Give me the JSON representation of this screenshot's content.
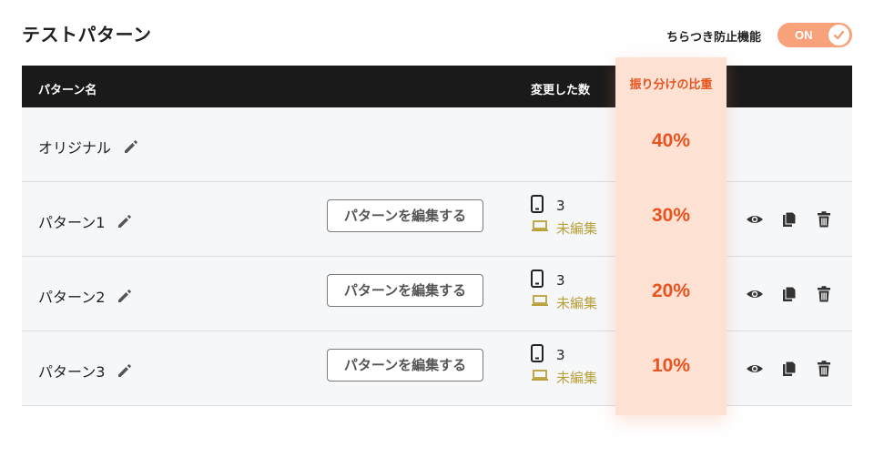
{
  "title": "テストパターン",
  "flicker": {
    "label": "ちらつき防止機能",
    "toggle_text": "ON"
  },
  "table": {
    "headers": {
      "name": "パターン名",
      "changes": "変更した数",
      "ratio": "振り分けの比重"
    },
    "rows": [
      {
        "name": "オリジナル",
        "ratio": "40%"
      },
      {
        "name": "パターン1",
        "edit_label": "パターンを編集する",
        "mobile_count": "3",
        "pc_status": "未編集",
        "ratio": "30%"
      },
      {
        "name": "パターン2",
        "edit_label": "パターンを編集する",
        "mobile_count": "3",
        "pc_status": "未編集",
        "ratio": "20%"
      },
      {
        "name": "パターン3",
        "edit_label": "パターンを編集する",
        "mobile_count": "3",
        "pc_status": "未編集",
        "ratio": "10%"
      }
    ]
  },
  "icons": {
    "pencil": "pencil-icon",
    "mobile": "smartphone-icon",
    "laptop": "laptop-icon",
    "preview": "eye-icon",
    "copy": "copy-icon",
    "delete": "trash-icon",
    "check": "check-icon"
  },
  "colors": {
    "accent": "#e8531f",
    "toggle_bg": "#f7a27a",
    "ratio_col_bg": "#fde1d3",
    "header_bg": "#1a1a1a",
    "row_bg": "#f6f7f9",
    "pc_status": "#b8a03b"
  }
}
